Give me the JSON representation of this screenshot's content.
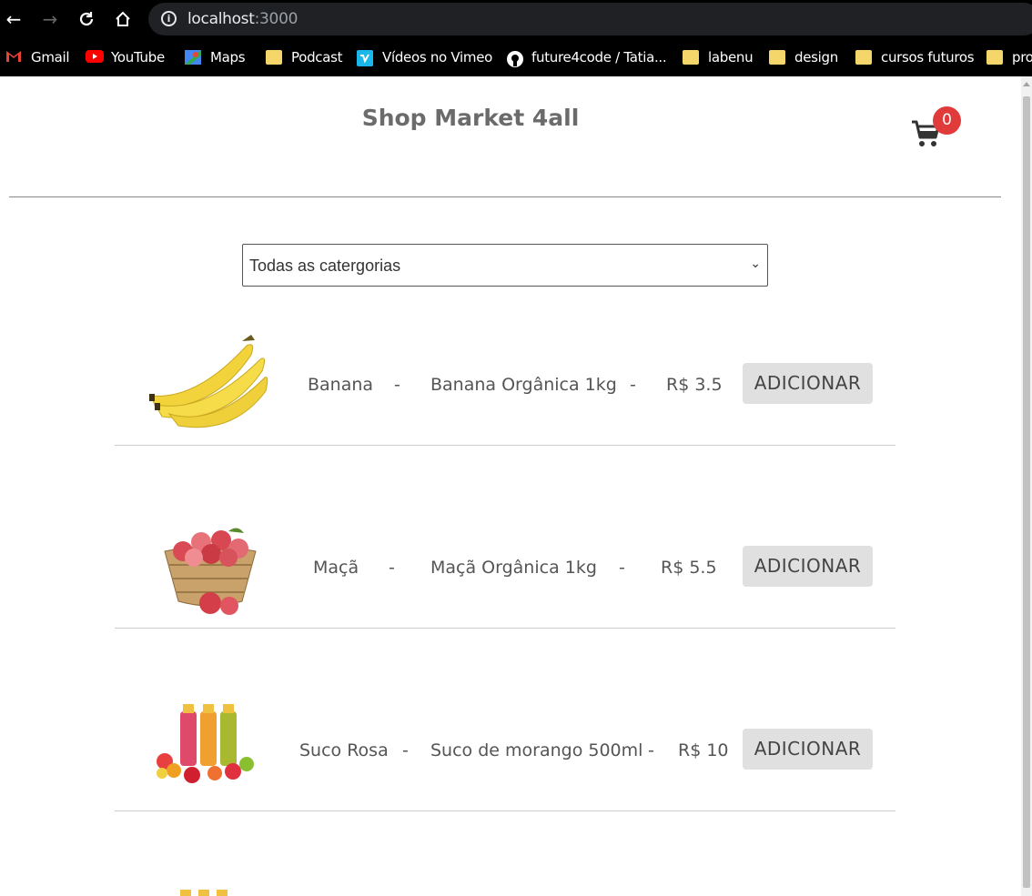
{
  "browser": {
    "url_host": "localhost",
    "url_port": ":3000",
    "bookmarks": [
      {
        "label": "Gmail",
        "icon": "gmail-icon"
      },
      {
        "label": "YouTube",
        "icon": "youtube-icon"
      },
      {
        "label": "Maps",
        "icon": "maps-icon"
      },
      {
        "label": "Podcast",
        "icon": "folder-icon"
      },
      {
        "label": "Vídeos no Vimeo",
        "icon": "vimeo-icon"
      },
      {
        "label": "future4code / Tatia...",
        "icon": "github-icon"
      },
      {
        "label": "labenu",
        "icon": "folder-icon"
      },
      {
        "label": "design",
        "icon": "folder-icon"
      },
      {
        "label": "cursos futuros",
        "icon": "folder-icon"
      },
      {
        "label": "pro",
        "icon": "folder-icon"
      }
    ]
  },
  "header": {
    "title": "Shop Market 4all",
    "cart_count": "0"
  },
  "filter": {
    "selected": "Todas as catergorias"
  },
  "products": [
    {
      "name": "Banana",
      "sep1": "-",
      "description": "Banana Orgânica 1kg",
      "sep2": "-",
      "price": "R$ 3.5",
      "button": "ADICIONAR",
      "image": "banana-image"
    },
    {
      "name": "Maçã",
      "sep1": "-",
      "description": "Maçã Orgânica 1kg",
      "sep2": "-",
      "price": "R$ 5.5",
      "button": "ADICIONAR",
      "image": "apple-basket-image"
    },
    {
      "name": "Suco Rosa",
      "sep1": "-",
      "description": "Suco de morango 500ml",
      "sep2": "-",
      "price": "R$ 10",
      "button": "ADICIONAR",
      "image": "juice-bottles-image"
    }
  ],
  "colors": {
    "cart_badge": "#e03a3a",
    "button_bg": "#e0e0e0",
    "title": "#6b6b6b"
  }
}
